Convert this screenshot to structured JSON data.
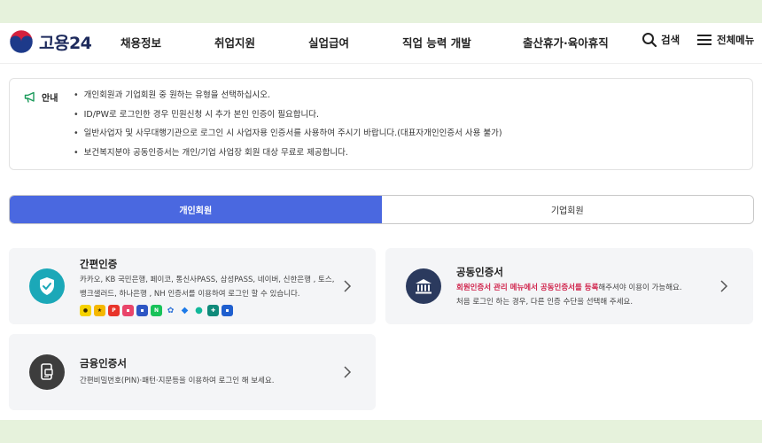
{
  "header": {
    "logo_text": "고용24",
    "nav": [
      "채용정보",
      "취업지원",
      "실업급여",
      "직업 능력 개발",
      "출산휴가·육아휴직"
    ],
    "search_label": "검색",
    "menu_label": "전체메뉴"
  },
  "notice": {
    "label": "안내",
    "items": [
      "개인회원과 기업회원 중 원하는 유형을 선택하십시오.",
      "ID/PW로 로그인한 경우 민원신청 시 추가 본인 인증이 필요합니다.",
      "일반사업자 및 사무대행기관으로 로그인 시 사업자용 인증서를 사용하여 주시기 바랍니다.(대표자개인인증서 사용 불가)",
      "보건복지분야 공동인증서는 개인/기업 사업장 회원 대상 무료로 제공합니다."
    ]
  },
  "tabs": {
    "personal": "개인회원",
    "business": "기업회원"
  },
  "cards": {
    "simple": {
      "title": "간편인증",
      "desc_line1": "카카오, KB 국민은행, 페이코, 통신사PASS, 삼성PASS, 네이버, 신한은행 , 토스,",
      "desc_line2": "뱅크샐러드, 하나은행 , NH 인증서를 이용하여 로그인 할 수 있습니다."
    },
    "joint": {
      "title": "공동인증서",
      "desc_highlight": "회원인증서 관리 메뉴에서 공동인증서를 등록",
      "desc_rest": "해주셔야 이용이 가능해요.",
      "desc_line2": "처음 로그인 하는 경우, 다른 인증 수단을 선택해 주세요."
    },
    "financial": {
      "title": "금융인증서",
      "desc_line1": "간편비밀번호(PIN)·패턴·지문등을 이용하여 로그인 해 보세요."
    }
  },
  "colors": {
    "accent": "#4a68e0",
    "highlight": "#d0254d",
    "outer_bg": "#e6f2dc",
    "card_bg": "#f4f5f7",
    "teal": "#1ba8b8",
    "navy": "#2b3a5e",
    "dark": "#3d3d3d"
  },
  "icons": [
    "search-icon",
    "menu-icon",
    "megaphone-icon",
    "shield-check-icon",
    "bank-icon",
    "phone-card-icon",
    "chevron-right-icon"
  ]
}
